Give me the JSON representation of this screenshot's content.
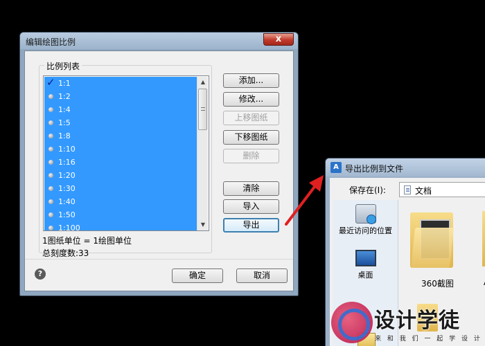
{
  "dialog1": {
    "title": "编辑绘图比例",
    "close_label": "x",
    "group_title": "比例列表",
    "scale_items": [
      "1:1",
      "1:2",
      "1:4",
      "1:5",
      "1:8",
      "1:10",
      "1:16",
      "1:20",
      "1:30",
      "1:40",
      "1:50",
      "1:100"
    ],
    "checked_index": 0,
    "unit_info": "1图纸单位 = 1绘图单位",
    "total_info": "总刻度数:33",
    "buttons": {
      "add": "添加...",
      "modify": "修改...",
      "move_up": "上移图纸",
      "move_down": "下移图纸",
      "delete": "删除",
      "clear": "清除",
      "import": "导入",
      "export": "导出",
      "ok": "确定",
      "cancel": "取消"
    },
    "help_label": "?"
  },
  "dialog2": {
    "title": "导出比例到文件",
    "save_in_label": "保存在(I):",
    "location": "文档",
    "places": {
      "recent": "最近访问的位置",
      "desktop": "桌面"
    },
    "folder_label": "360截图",
    "truncated_label": "A"
  },
  "watermark": {
    "title": "设计学徒",
    "subtitle": "来 和 我 们 一 起 学 设 计"
  },
  "colors": {
    "selection": "#3399ff",
    "titlebar": "#b9cbe0",
    "arrow": "#e02020"
  }
}
